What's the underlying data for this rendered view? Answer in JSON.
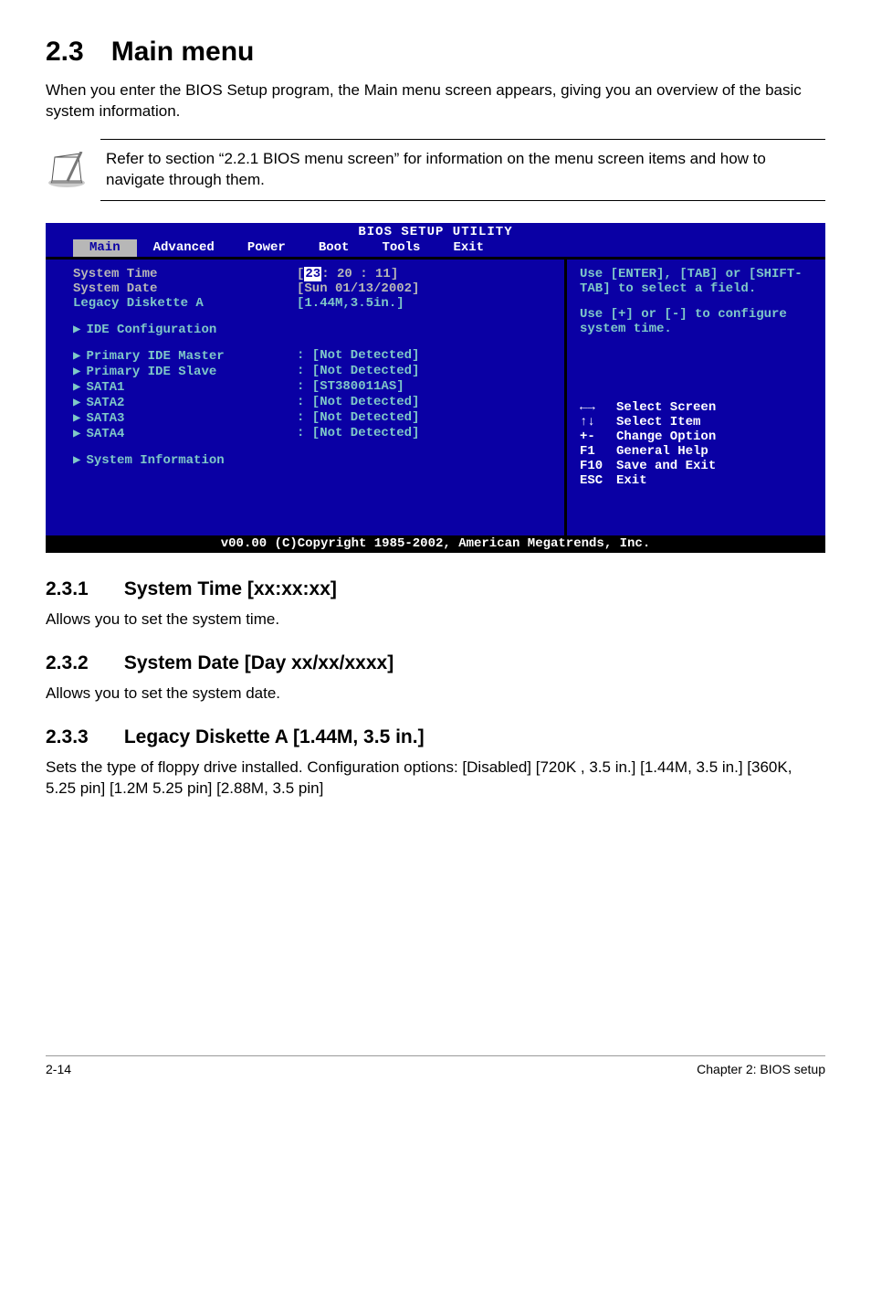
{
  "h1": "2.3 Main menu",
  "intro": "When you enter the BIOS Setup program, the Main menu screen appears, giving you an overview of the basic system information.",
  "note": "Refer to section “2.2.1 BIOS menu screen” for information on the menu screen items and how to navigate through them.",
  "bios": {
    "title": "BIOS SETUP UTILITY",
    "tabs": [
      "Main",
      "Advanced",
      "Power",
      "Boot",
      "Tools",
      "Exit"
    ],
    "selected_tab": 0,
    "left_items": [
      {
        "label": "System Time",
        "value_pre": "[",
        "value_hl": "23",
        "value_post": ": 20 : 11]",
        "gray": true
      },
      {
        "label": "System Date",
        "value": "[Sun 01/13/2002]",
        "gray": true
      },
      {
        "label": "Legacy Diskette A",
        "value": "[1.44M,3.5in.]"
      },
      {
        "spacer": true
      },
      {
        "label": "IDE Configuration",
        "tri": true
      },
      {
        "spacer": true
      },
      {
        "label": "Primary IDE Master",
        "tri": true,
        "value": ":  [Not Detected]"
      },
      {
        "label": "Primary IDE Slave",
        "tri": true,
        "value": ":  [Not Detected]"
      },
      {
        "label": "SATA1",
        "tri": true,
        "value": ":  [ST380011AS]"
      },
      {
        "label": "SATA2",
        "tri": true,
        "value": ":  [Not Detected]"
      },
      {
        "label": "SATA3",
        "tri": true,
        "value": ":  [Not Detected]"
      },
      {
        "label": "SATA4",
        "tri": true,
        "value": ":  [Not Detected]"
      },
      {
        "spacer": true
      },
      {
        "label": "System Information",
        "tri": true
      }
    ],
    "help1": "Use [ENTER], [TAB] or [SHIFT-TAB] to select a field.",
    "help2": "Use [+] or [-] to configure system time.",
    "nav": [
      {
        "k": "←→",
        "t": "Select Screen"
      },
      {
        "k": "↑↓",
        "t": "Select Item"
      },
      {
        "k": "+-",
        "t": "Change Option"
      },
      {
        "k": "F1",
        "t": "General Help"
      },
      {
        "k": "F10",
        "t": "Save and Exit"
      },
      {
        "k": "ESC",
        "t": "Exit"
      }
    ],
    "footer": "v00.00 (C)Copyright 1985-2002, American Megatrends, Inc."
  },
  "s231_num": "2.3.1",
  "s231_title": "System Time [xx:xx:xx]",
  "s231_body": "Allows you to set the system time.",
  "s232_num": "2.3.2",
  "s232_title": "System Date [Day xx/xx/xxxx]",
  "s232_body": "Allows you to set the system date.",
  "s233_num": "2.3.3",
  "s233_title": "Legacy Diskette A [1.44M, 3.5 in.]",
  "s233_body": "Sets the type of floppy drive installed. Configuration options: [Disabled] [720K , 3.5 in.] [1.44M, 3.5 in.] [360K, 5.25 pin] [1.2M 5.25 pin] [2.88M, 3.5 pin]",
  "footer_left": "2-14",
  "footer_right": "Chapter 2: BIOS setup"
}
